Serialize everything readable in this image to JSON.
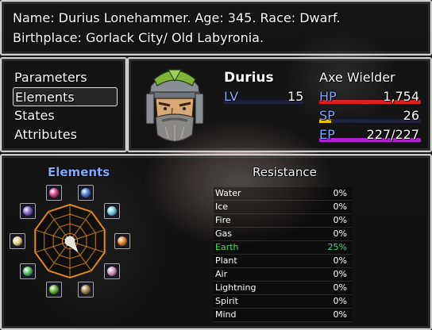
{
  "info": {
    "line1": "Name: Durius Lonehammer. Age: 345. Race: Dwarf.",
    "line2": "Birthplace: Gorlack City/ Old Labyronia."
  },
  "menu": {
    "items": [
      {
        "label": "Parameters",
        "selected": false
      },
      {
        "label": "Elements",
        "selected": true
      },
      {
        "label": "States",
        "selected": false
      },
      {
        "label": "Attributes",
        "selected": false
      }
    ]
  },
  "actor": {
    "name": "Durius",
    "class": "Axe Wielder",
    "lv_label": "LV",
    "level": "15",
    "hp_label": "HP",
    "hp": "1,754",
    "hp_ratio": 1.0,
    "sp_label": "SP",
    "sp": "26",
    "sp_ratio": 0.12,
    "ep_label": "EP",
    "ep": "227/227",
    "ep_ratio": 1.0,
    "colors": {
      "hp": "#e02020",
      "sp": "#f0c000",
      "ep": "#b020d0",
      "lv": "#2a2a6a"
    }
  },
  "elements_panel": {
    "title": "Elements",
    "resistance_title": "Resistance",
    "highlight_color": "#40e060",
    "rows": [
      {
        "name": "Water",
        "value": "0%",
        "highlight": false,
        "icon": "water-orb",
        "color": "#4a7bd0"
      },
      {
        "name": "Ice",
        "value": "0%",
        "highlight": false,
        "icon": "ice-orb",
        "color": "#70c8e0"
      },
      {
        "name": "Fire",
        "value": "0%",
        "highlight": false,
        "icon": "fire-orb",
        "color": "#e08020"
      },
      {
        "name": "Gas",
        "value": "0%",
        "highlight": false,
        "icon": "gas-orb",
        "color": "#d090c0"
      },
      {
        "name": "Earth",
        "value": "25%",
        "highlight": true,
        "icon": "earth-orb",
        "color": "#a08040"
      },
      {
        "name": "Plant",
        "value": "0%",
        "highlight": false,
        "icon": "plant-orb",
        "color": "#60b030"
      },
      {
        "name": "Air",
        "value": "0%",
        "highlight": false,
        "icon": "air-orb",
        "color": "#50c060"
      },
      {
        "name": "Lightning",
        "value": "0%",
        "highlight": false,
        "icon": "lightning-orb",
        "color": "#e0d080"
      },
      {
        "name": "Spirit",
        "value": "0%",
        "highlight": false,
        "icon": "spirit-orb",
        "color": "#8060d0"
      },
      {
        "name": "Mind",
        "value": "0%",
        "highlight": false,
        "icon": "mind-orb",
        "color": "#d04080"
      }
    ]
  }
}
